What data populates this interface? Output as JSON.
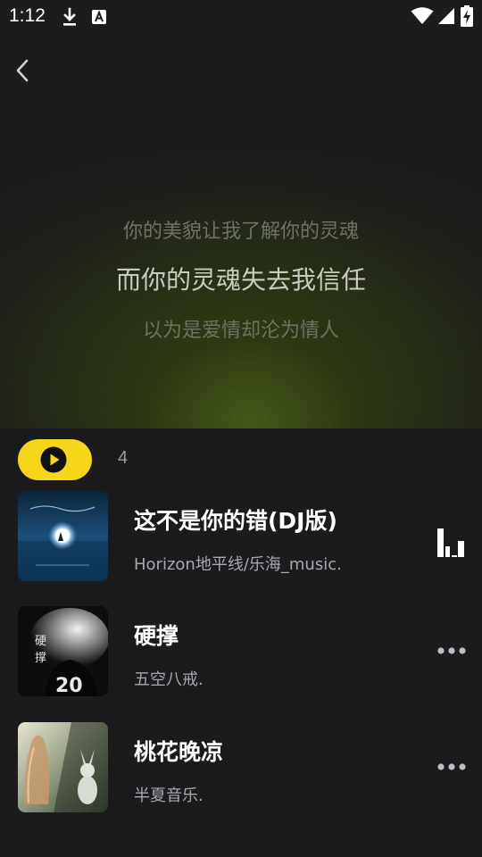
{
  "status_bar": {
    "time": "1:12",
    "icons": [
      "download-icon",
      "a-notification-icon",
      "wifi-icon",
      "signal-icon",
      "battery-charging-icon"
    ]
  },
  "header": {
    "back_icon": "chevron-left-icon"
  },
  "lyrics": {
    "previous": "你的美貌让我了解你的灵魂",
    "current": "而你的灵魂失去我信任",
    "next": "以为是爱情却沦为情人"
  },
  "playlist": {
    "play_all_icon": "play-circle-icon",
    "count": "4",
    "accent_color": "#f7d51a",
    "songs": [
      {
        "title": "这不是你的错(DJ版)",
        "artist": "Horizon地平线/乐海_music.",
        "status_icon": "now-playing-bars-icon"
      },
      {
        "title": "硬撑",
        "artist": "五空八戒.",
        "cover_text": "硬撑",
        "status_icon": "more-icon"
      },
      {
        "title": "桃花晚凉",
        "artist": "半夏音乐.",
        "status_icon": "more-icon"
      }
    ]
  }
}
